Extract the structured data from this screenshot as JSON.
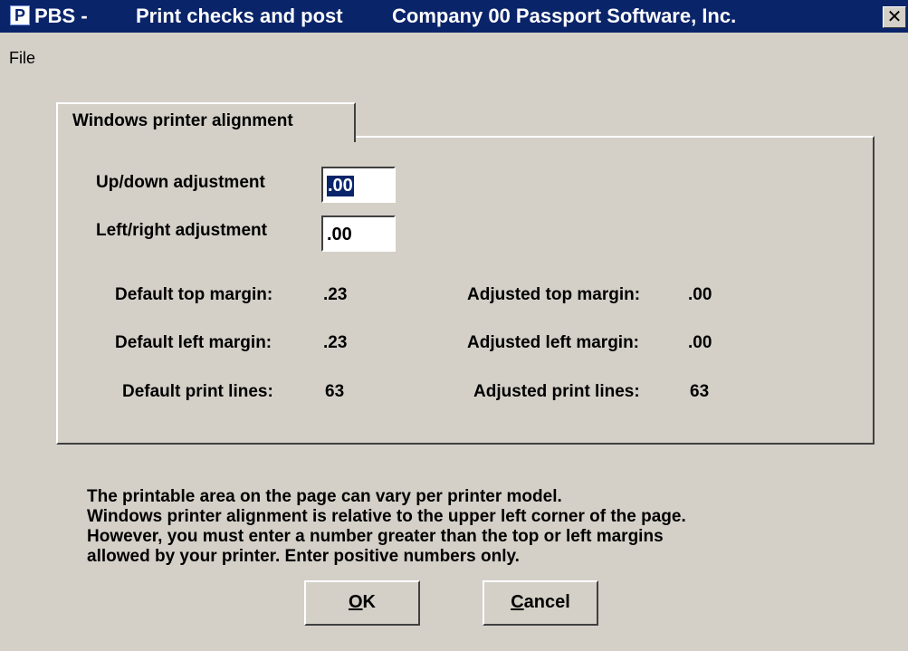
{
  "window": {
    "app_prefix": "PBS -",
    "task": "Print checks and post",
    "company": "Company 00  Passport Software, Inc.",
    "icon_letter": "P",
    "close_glyph": "✕"
  },
  "menu": {
    "items": [
      "File"
    ]
  },
  "tab": {
    "label": "Windows printer alignment"
  },
  "fields": {
    "updown_label": "Up/down adjustment",
    "updown_value": ".00",
    "leftright_label": "Left/right adjustment",
    "leftright_value": ".00"
  },
  "margins": {
    "default_top_label": "Default top margin:",
    "default_top_value": ".23",
    "default_left_label": "Default left margin:",
    "default_left_value": ".23",
    "default_lines_label": "Default print lines:",
    "default_lines_value": "63",
    "adjusted_top_label": "Adjusted top margin:",
    "adjusted_top_value": ".00",
    "adjusted_left_label": "Adjusted left margin:",
    "adjusted_left_value": ".00",
    "adjusted_lines_label": "Adjusted print lines:",
    "adjusted_lines_value": "63"
  },
  "info_lines": [
    "The printable area on the page can vary per printer model.",
    "Windows printer alignment is relative to the upper left corner of the page.",
    "However, you must enter a number greater than the top or left margins",
    "allowed by your printer. Enter positive numbers only."
  ],
  "buttons": {
    "ok_mnemonic": "O",
    "ok_rest": "K",
    "cancel_mnemonic": "C",
    "cancel_rest": "ancel"
  },
  "colors": {
    "titlebar": "#0a246a",
    "face": "#d4d0c8",
    "selection": "#0a246a"
  }
}
